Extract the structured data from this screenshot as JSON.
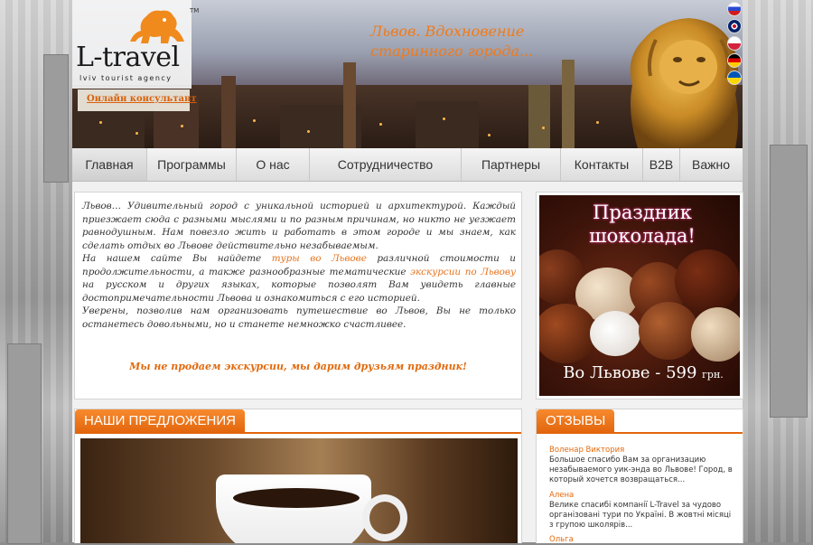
{
  "header": {
    "brand": "L-travel",
    "tm": "TM",
    "brand_sub": "lviv tourist agency",
    "consult_link": "Онлайн консультант",
    "slogan_line1": "Львов. Вдохновение",
    "slogan_line2": "старинного города...",
    "languages": [
      "ru",
      "en",
      "pl",
      "de",
      "ua"
    ]
  },
  "nav": {
    "items": [
      {
        "label": "Главная"
      },
      {
        "label": "Программы"
      },
      {
        "label": "О нас"
      },
      {
        "label": "Сотрудничество"
      },
      {
        "label": "Партнеры"
      },
      {
        "label": "Контакты"
      },
      {
        "label": "B2B"
      },
      {
        "label": "Важно"
      }
    ]
  },
  "intro": {
    "p1": "Львов… Удивительный город с уникальной историей и архитектурой. Каждый приезжает сюда с разными мыслями и по разным причинам, но никто не уезжает равнодушным. Нам повезло жить и работать в этом городе и мы знаем, как сделать отдых во Львове действительно незабываемым.",
    "p2_start": "На нашем сайте Вы найдете ",
    "p2_link1": "туры во Львове",
    "p2_mid": " различной стоимости и продолжительности, а также разнообразные тематические ",
    "p2_link2": "экскурсии по Львову",
    "p2_end": " на русском и других языках, которые позволят Вам увидеть главные достопримечательности Львова и ознакомиться с его историей.",
    "p3": "Уверены, позволив нам организовать путешествие во Львов, Вы не только останетесь довольными, но и станете немножко счастливее.",
    "motto": "Мы не продаем экскурсии, мы дарим друзьям праздник!"
  },
  "banner": {
    "title_line1": "Праздник",
    "title_line2": "шоколада!",
    "price_text": "Во Львове - 599",
    "currency": "грн."
  },
  "offers": {
    "heading": "НАШИ ПРЕДЛОЖЕНИЯ"
  },
  "reviews": {
    "heading": "ОТЗЫВЫ",
    "items": [
      {
        "name": "Воленар Виктория",
        "text": "Большое спасибо Вам за организацию незабываемого уик-энда во Львове! Город, в который хочется возвращаться..."
      },
      {
        "name": "Алена",
        "text": "Велике спасибі компанії L-Travel за чудово організовані тури по Україні. В жовтні місяці з групою школярів..."
      },
      {
        "name": "Ольга",
        "text": ""
      }
    ]
  },
  "colors": {
    "accent": "#e2650c",
    "link": "#e4731e",
    "text": "#333333"
  }
}
